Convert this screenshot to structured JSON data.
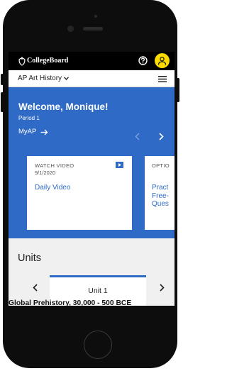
{
  "header": {
    "brand": "CollegeBoard"
  },
  "course_bar": {
    "course": "AP Art History"
  },
  "hero": {
    "welcome": "Welcome, Monique!",
    "period": "Period 1",
    "myap_link": "MyAP"
  },
  "cards": [
    {
      "kicker": "WATCH VIDEO",
      "date": "9/1/2020",
      "title": "Daily Video"
    },
    {
      "kicker": "OPTIO",
      "title": "Pract Free- Ques"
    }
  ],
  "units": {
    "title": "Units",
    "selected_unit": "Unit 1",
    "unit_heading": "Global Prehistory, 30,000 - 500 BCE"
  },
  "colors": {
    "accent_blue": "#2f6ac7",
    "avatar_yellow": "#fedb00",
    "header_black": "#000000",
    "units_bg": "#f0f0f0"
  }
}
